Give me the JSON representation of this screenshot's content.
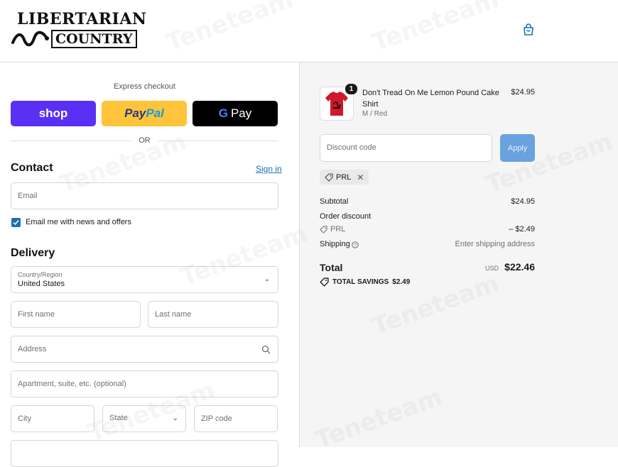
{
  "brand": {
    "line1": "LIBERTARIAN",
    "line2": "COUNTRY"
  },
  "express": {
    "title": "Express checkout",
    "shop": "shop",
    "paypal_a": "Pay",
    "paypal_b": "Pal",
    "gpay_g": "G",
    "gpay": "Pay",
    "or": "OR"
  },
  "contact": {
    "title": "Contact",
    "signin": "Sign in",
    "email_placeholder": "Email",
    "news_label": "Email me with news and offers",
    "news_checked": true
  },
  "delivery": {
    "title": "Delivery",
    "country_label": "Country/Region",
    "country_value": "United States",
    "first_name": "First name",
    "last_name": "Last name",
    "address": "Address",
    "apartment": "Apartment, suite, etc. (optional)",
    "city": "City",
    "state": "State",
    "zip": "ZIP code"
  },
  "summary": {
    "product": {
      "name": "Don't Tread On Me Lemon Pound Cake Shirt",
      "variant": "M / Red",
      "price": "$24.95",
      "quantity": "1"
    },
    "discount_placeholder": "Discount code",
    "apply": "Apply",
    "tag": "PRL",
    "subtotal_label": "Subtotal",
    "subtotal_value": "$24.95",
    "order_discount_label": "Order discount",
    "discount_code": "PRL",
    "discount_value": "– $2.49",
    "shipping_label": "Shipping",
    "shipping_value": "Enter shipping address",
    "total_label": "Total",
    "currency": "USD",
    "total_value": "$22.46",
    "savings_label": "TOTAL SAVINGS",
    "savings_value": "$2.49"
  },
  "watermark": "Teneteam",
  "colors": {
    "accent": "#1773b0",
    "shop": "#5a31f4",
    "paypal": "#ffc439",
    "apply": "#6aa2dd"
  }
}
